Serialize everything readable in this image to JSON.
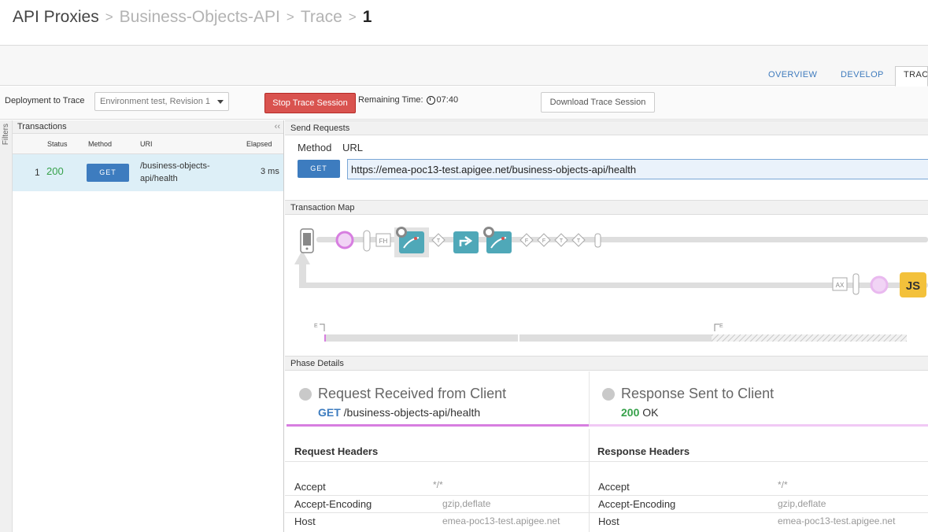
{
  "breadcrumb": {
    "root": "API Proxies",
    "proxy": "Business-Objects-API",
    "section": "Trace",
    "current": "1"
  },
  "tabs": [
    {
      "label": "OVERVIEW"
    },
    {
      "label": "DEVELOP"
    },
    {
      "label": "TRAC"
    }
  ],
  "toolbar": {
    "deployment_label": "Deployment to Trace",
    "environment_value": "Environment test, Revision 1",
    "stop_label": "Stop Trace Session",
    "remaining_label": "Remaining Time:",
    "remaining_value": "07:40",
    "download_label": "Download Trace Session"
  },
  "filters_label": "Filters",
  "transactions": {
    "title": "Transactions",
    "collapse": "‹‹",
    "columns": [
      "Status",
      "Method",
      "URI",
      "Elapsed"
    ],
    "rows": [
      {
        "num": "1",
        "status": "200",
        "method": "GET",
        "uri": "/business-objects-api/health",
        "elapsed": "3 ms"
      }
    ]
  },
  "send_requests": {
    "title": "Send Requests",
    "method_label": "Method",
    "url_label": "URL",
    "method": "GET",
    "url": "https://emea-poc13-test.apigee.net/business-objects-api/health"
  },
  "transaction_map": {
    "title": "Transaction Map",
    "labels": {
      "fh": "FH",
      "t": "T",
      "f": "F",
      "ax": "AX",
      "js": "JS",
      "e": "E"
    }
  },
  "phase_details": {
    "title": "Phase Details",
    "request": {
      "title": "Request Received from Client",
      "method": "GET",
      "path": "/business-objects-api/health"
    },
    "response": {
      "title": "Response Sent to Client",
      "code": "200",
      "text": "OK"
    }
  },
  "request_headers": {
    "title": "Request Headers",
    "rows": [
      {
        "name": "Accept",
        "value": "*/*"
      },
      {
        "name": "Accept-Encoding",
        "value": "gzip,deflate"
      },
      {
        "name": "Host",
        "value": "emea-poc13-test.apigee.net"
      }
    ]
  },
  "response_headers": {
    "title": "Response Headers",
    "rows": [
      {
        "name": "Accept",
        "value": "*/*"
      },
      {
        "name": "Accept-Encoding",
        "value": "gzip,deflate"
      },
      {
        "name": "Host",
        "value": "emea-poc13-test.apigee.net"
      }
    ]
  },
  "colors": {
    "accent": "#3d7cbf",
    "stop": "#d9534f",
    "success": "#36a14a",
    "policy": "#4fa8b8",
    "js": "#f3c13b",
    "flow_marker": "#d77ee0"
  }
}
